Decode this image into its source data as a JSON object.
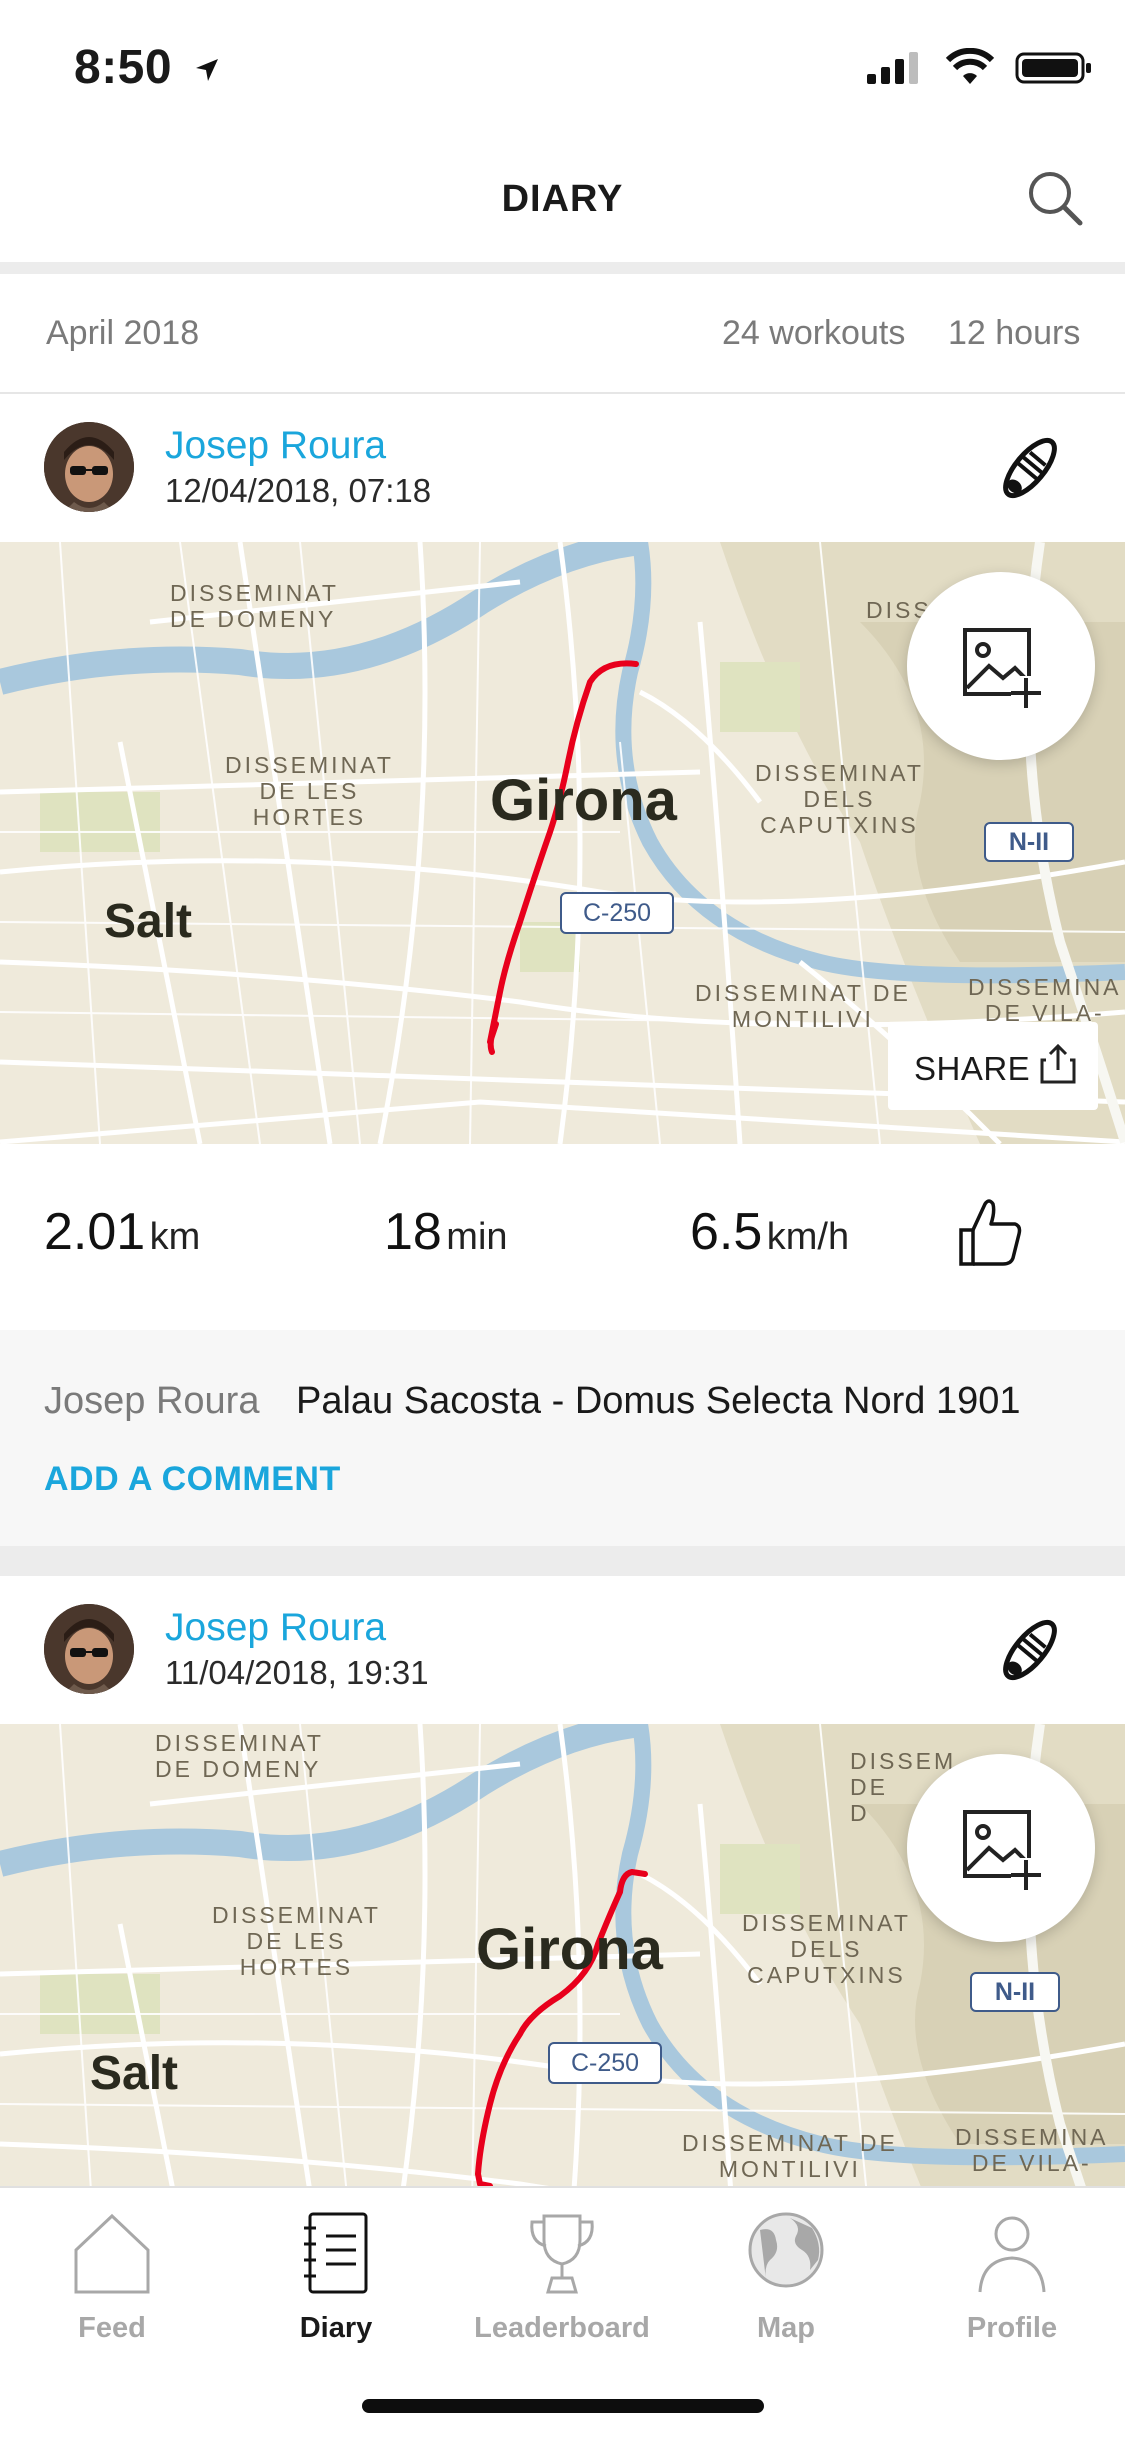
{
  "status_bar": {
    "time": "8:50"
  },
  "header": {
    "title": "DIARY"
  },
  "summary": {
    "month": "April 2018",
    "workouts": "24 workouts",
    "hours": "12 hours"
  },
  "cards": [
    {
      "user_name": "Josep Roura",
      "date": "12/04/2018, 07:18",
      "map_labels": {
        "city": "Girona",
        "salt": "Salt",
        "domeny": "DISSEMINAT\nDE DOMENY",
        "hortes": "DISSEMINAT\nDE LES\nHORTES",
        "caputxins": "DISSEMINAT\nDELS\nCAPUTXINS",
        "montilivi": "DISSEMINAT DE\nMONTILIVI",
        "vila": "DISSEMINA\nDE VILA-",
        "road_c250": "C-250",
        "road_n2": "N-II",
        "top_right": "DISS"
      },
      "share_label": "SHARE",
      "distance_value": "2.01",
      "distance_unit": "km",
      "duration_value": "18",
      "duration_unit": "min",
      "speed_value": "6.5",
      "speed_unit": "km/h",
      "comment_author": "Josep Roura",
      "comment_text": "Palau Sacosta - Domus Selecta Nord 1901",
      "add_comment": "ADD A COMMENT"
    },
    {
      "user_name": "Josep Roura",
      "date": "11/04/2018, 19:31",
      "map_labels": {
        "city": "Girona",
        "salt": "Salt",
        "domeny": "DISSEMINAT\nDE DOMENY",
        "hortes": "DISSEMINAT\nDE LES\nHORTES",
        "caputxins": "DISSEMINAT\nDELS\nCAPUTXINS",
        "montilivi": "DISSEMINAT DE\nMONTILIVI",
        "vila": "DISSEMINA\nDE VILA-",
        "road_c250": "C-250",
        "road_n2": "N-II",
        "top_right": "DISSEM\nDE\nD"
      }
    }
  ],
  "tabs": [
    {
      "label": "Feed",
      "icon": "home-icon",
      "active": false
    },
    {
      "label": "Diary",
      "icon": "notebook-icon",
      "active": true
    },
    {
      "label": "Leaderboard",
      "icon": "trophy-icon",
      "active": false
    },
    {
      "label": "Map",
      "icon": "globe-icon",
      "active": false
    },
    {
      "label": "Profile",
      "icon": "person-icon",
      "active": false
    }
  ],
  "colors": {
    "accent": "#1aa6dc",
    "route": "#e8001c",
    "map_bg": "#efeadb"
  }
}
